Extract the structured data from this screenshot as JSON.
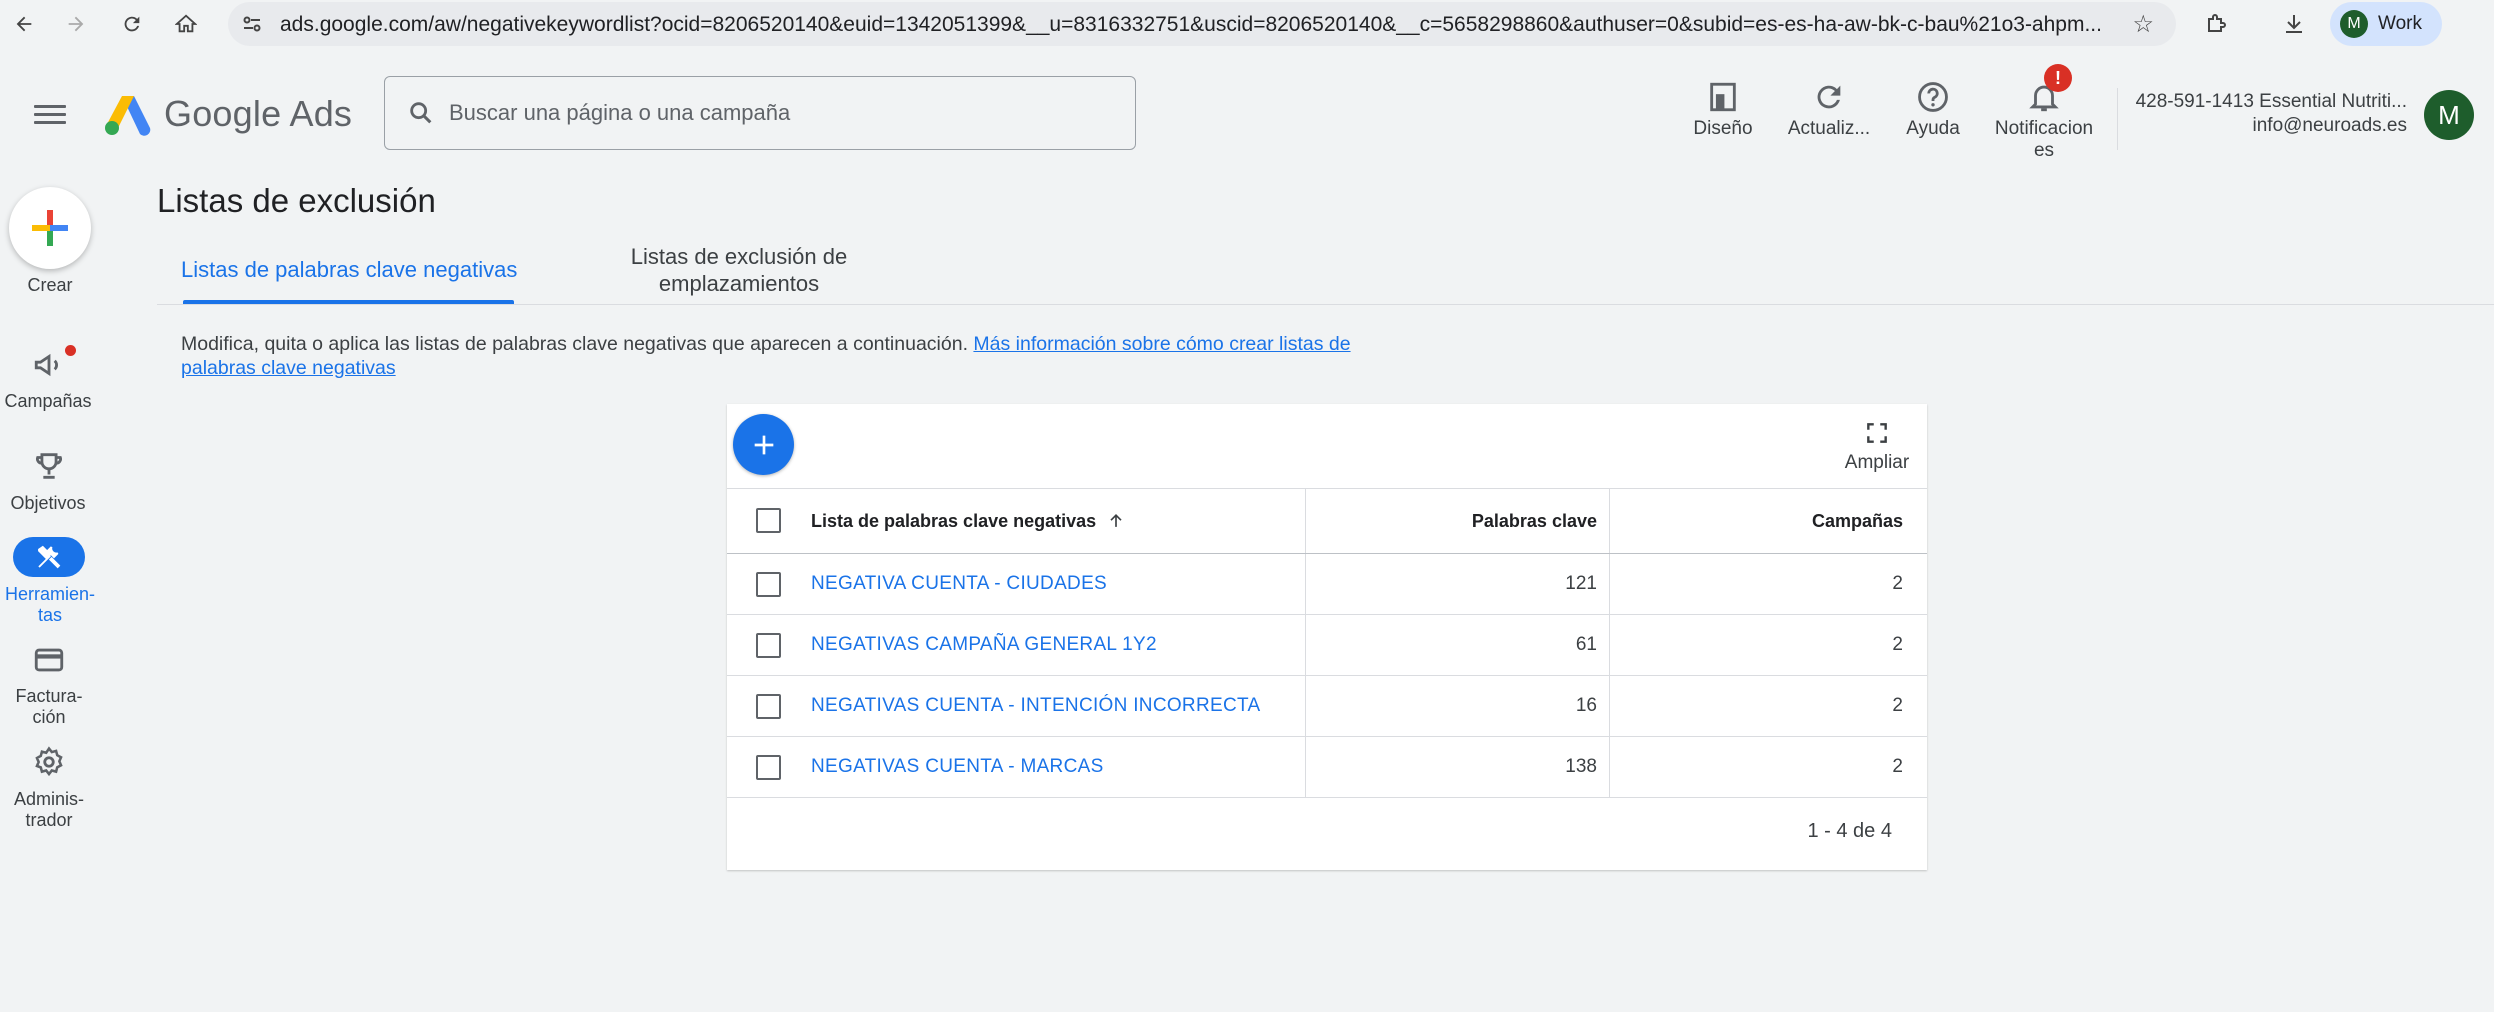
{
  "browser": {
    "url": "ads.google.com/aw/negativekeywordlist?ocid=8206520140&euid=1342051399&__u=8316332751&uscid=8206520140&__c=5658298860&authuser=0&subid=es-es-ha-aw-bk-c-bau%21o3-ahpm...",
    "profile_initial": "M",
    "profile_label": "Work"
  },
  "header": {
    "product_name": "Google Ads",
    "search_placeholder": "Buscar una página o una campaña",
    "tools": [
      {
        "label": "Diseño",
        "icon": "appearance-icon"
      },
      {
        "label": "Actualiz...",
        "icon": "refresh-icon"
      },
      {
        "label": "Ayuda",
        "icon": "help-icon"
      },
      {
        "label": "Notificacion es",
        "label_line1": "Notificacion",
        "label_line2": "es",
        "icon": "bell-icon",
        "badge": "!"
      }
    ],
    "account_id_name": "428-591-1413 Essential Nutriti...",
    "account_email": "info@neuroads.es",
    "avatar_initial": "M"
  },
  "left_nav": {
    "create_label": "Crear",
    "items": [
      {
        "label": "Campañas",
        "icon": "campaigns-icon"
      },
      {
        "label": "Objetivos",
        "icon": "trophy-icon"
      },
      {
        "label_line1": "Herramien-",
        "label_line2": "tas",
        "icon": "tools-icon",
        "active": true
      },
      {
        "label_line1": "Factura-",
        "label_line2": "ción",
        "icon": "billing-icon"
      },
      {
        "label_line1": "Adminis-",
        "label_line2": "trador",
        "icon": "admin-gear-icon"
      }
    ]
  },
  "page": {
    "title": "Listas de exclusión",
    "tabs": [
      {
        "label": "Listas de palabras clave negativas",
        "active": true
      },
      {
        "label_line1": "Listas de exclusión de",
        "label_line2": "emplazamientos",
        "active": false
      }
    ],
    "description": "Modifica, quita o aplica las listas de palabras clave negativas que aparecen a continuación.",
    "description_link_line1": "Más información sobre cómo crear listas de",
    "description_link_line2": "palabras clave negativas"
  },
  "table": {
    "expand_label": "Ampliar",
    "columns": [
      "Lista de palabras clave negativas",
      "Palabras clave",
      "Campañas"
    ],
    "rows": [
      {
        "name": "NEGATIVA CUENTA - CIUDADES",
        "keywords": "121",
        "campaigns": "2"
      },
      {
        "name": "NEGATIVAS CAMPAÑA GENERAL 1Y2",
        "keywords": "61",
        "campaigns": "2"
      },
      {
        "name": "NEGATIVAS CUENTA - INTENCIÓN INCORRECTA",
        "keywords": "16",
        "campaigns": "2"
      },
      {
        "name": "NEGATIVAS CUENTA - MARCAS",
        "keywords": "138",
        "campaigns": "2"
      }
    ],
    "pagination": "1 - 4 de 4"
  },
  "colors": {
    "accent": "#1a73e8",
    "badge": "#d93025",
    "avatar": "#1e5d2c",
    "background": "#f1f3f4"
  }
}
